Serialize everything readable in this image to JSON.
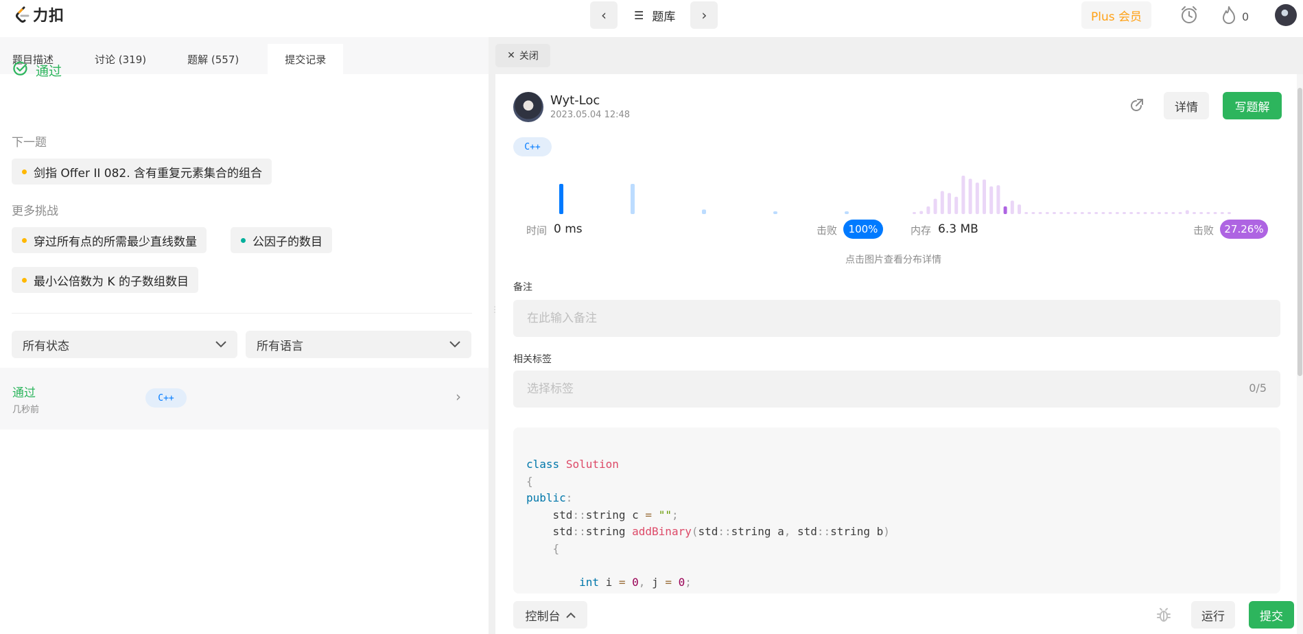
{
  "header": {
    "logo_text": "力扣",
    "problem_bank": "题库",
    "plus_member": "Plus 会员",
    "streak_count": "0"
  },
  "left_tabs": [
    {
      "label": "题目描述"
    },
    {
      "label": "讨论 (319)"
    },
    {
      "label": "题解 (557)"
    },
    {
      "label": "提交记录"
    }
  ],
  "result": {
    "status": "通过",
    "next_label": "下一题",
    "next_problem": "剑指 Offer II 082. 含有重复元素集合的组合",
    "more_label": "更多挑战",
    "challenges": [
      {
        "text": "穿过所有点的所需最少直线数量",
        "color": "#ffb800"
      },
      {
        "text": "公因子的数目",
        "color": "#00af9b"
      },
      {
        "text": "最小公倍数为 K 的子数组数目",
        "color": "#ffb800"
      }
    ],
    "next_dot_color": "#ffb800"
  },
  "filters": {
    "status": "所有状态",
    "language": "所有语言"
  },
  "submission_row": {
    "status": "通过",
    "time": "几秒前",
    "language": "C++"
  },
  "close_tab": "关闭",
  "detail": {
    "author": "Wyt-Loc",
    "date": "2023.05.04 12:48",
    "language": "C++",
    "detail_button": "详情",
    "write_solution_button": "写题解",
    "time_label": "时间",
    "time_value": "0 ms",
    "beat_label": "击败",
    "time_beat": "100%",
    "memory_label": "内存",
    "memory_value": "6.3 MB",
    "memory_beat": "27.26%",
    "distribution_hint": "点击图片查看分布详情",
    "note_label": "备注",
    "note_placeholder": "在此输入备注",
    "tags_label": "相关标签",
    "tags_placeholder": "选择标签",
    "tags_count": "0/5",
    "time_dist": [
      1,
      0,
      0,
      0,
      1,
      0,
      0,
      0,
      0.15,
      0,
      0,
      0,
      0.08,
      0,
      0,
      0,
      0.08
    ],
    "memory_dist": [
      0.05,
      0.08,
      0.2,
      0.4,
      0.6,
      0.55,
      0.45,
      1,
      0.92,
      0.82,
      0.9,
      0.72,
      0.75,
      0.2,
      0.35,
      0.25,
      0.05,
      0.05,
      0.05,
      0.05,
      0.05,
      0.05,
      0.05,
      0.05,
      0.05,
      0.05,
      0.05,
      0.05,
      0.05,
      0.05,
      0.05,
      0.05,
      0.05,
      0.05,
      0.05,
      0.05,
      0.05,
      0.05,
      0.05,
      0.1,
      0.05,
      0.05,
      0.05,
      0.05,
      0.05,
      0.05
    ],
    "memory_highlight_index": 13,
    "colors": {
      "time_bar": "#007aff",
      "memory_bar": "#ae64e2",
      "time_beat_bg": "#007aff",
      "memory_beat_bg": "#ae64e2",
      "accent_green": "#2db55d"
    }
  },
  "code_lines": [
    [
      [
        "kw",
        "class"
      ],
      [
        "t",
        " "
      ],
      [
        "cls",
        "Solution"
      ]
    ],
    [
      [
        "pn",
        "{"
      ]
    ],
    [
      [
        "kw",
        "public"
      ],
      [
        "pn",
        ":"
      ]
    ],
    [
      [
        "t",
        "    std"
      ],
      [
        "pn",
        "::"
      ],
      [
        "t",
        "string c "
      ],
      [
        "op",
        "="
      ],
      [
        "t",
        " "
      ],
      [
        "str",
        "\"\""
      ],
      [
        "pn",
        ";"
      ]
    ],
    [
      [
        "t",
        "    std"
      ],
      [
        "pn",
        "::"
      ],
      [
        "t",
        "string "
      ],
      [
        "fn",
        "addBinary"
      ],
      [
        "pn",
        "("
      ],
      [
        "t",
        "std"
      ],
      [
        "pn",
        "::"
      ],
      [
        "t",
        "string a"
      ],
      [
        "pn",
        ","
      ],
      [
        "t",
        " std"
      ],
      [
        "pn",
        "::"
      ],
      [
        "t",
        "string b"
      ],
      [
        "pn",
        ")"
      ]
    ],
    [
      [
        "t",
        "    "
      ],
      [
        "pn",
        "{"
      ]
    ],
    [
      [
        "t",
        ""
      ]
    ],
    [
      [
        "t",
        "        "
      ],
      [
        "kw",
        "int"
      ],
      [
        "t",
        " i "
      ],
      [
        "op",
        "="
      ],
      [
        "t",
        " "
      ],
      [
        "num",
        "0"
      ],
      [
        "pn",
        ","
      ],
      [
        "t",
        " j "
      ],
      [
        "op",
        "="
      ],
      [
        "t",
        " "
      ],
      [
        "num",
        "0"
      ],
      [
        "pn",
        ";"
      ]
    ]
  ],
  "bottom": {
    "console": "控制台",
    "run": "运行",
    "submit": "提交"
  }
}
